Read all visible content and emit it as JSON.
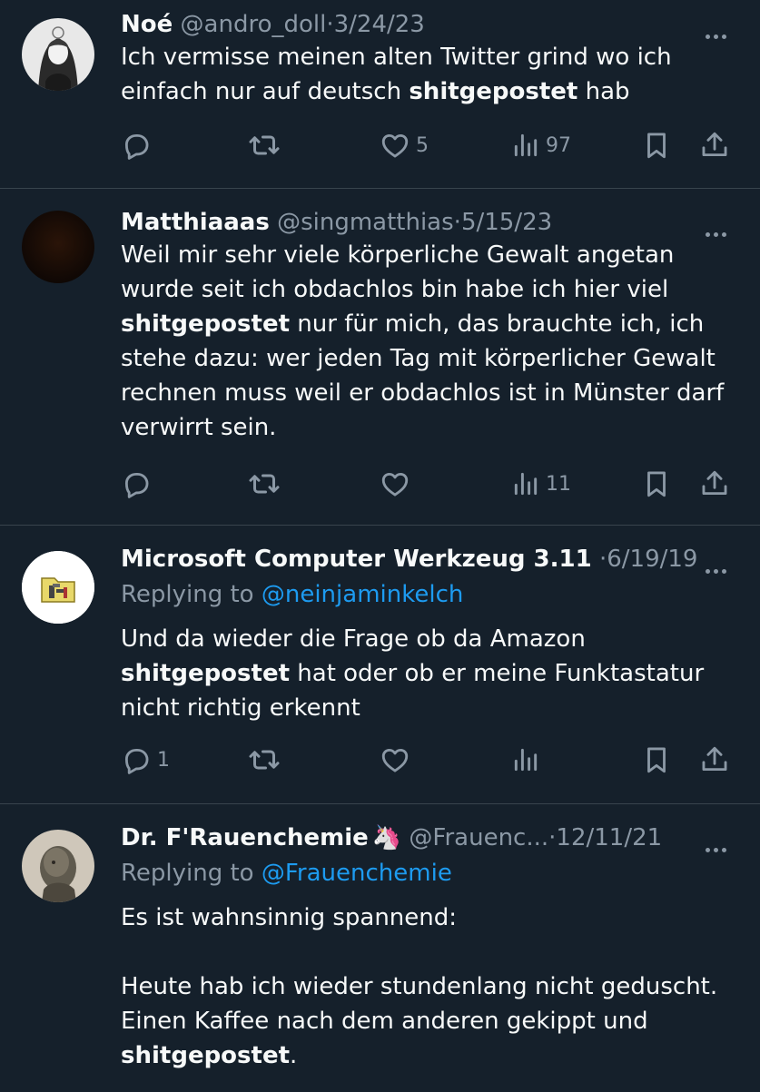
{
  "tweets": [
    {
      "name": "Noé",
      "handle": "@andro_doll",
      "dot": "·",
      "date": "3/24/23",
      "text_before": "Ich vermisse meinen alten Twitter grind wo ich einfach nur auf deutsch ",
      "bold": "shitgepostet",
      "text_after": " hab",
      "replies": "",
      "likes": "5",
      "views": "97"
    },
    {
      "name": "Matthiaaas",
      "handle": "@singmatthias",
      "dot": "·",
      "date": "5/15/23",
      "text_before": "Weil mir sehr viele körperliche Gewalt angetan wurde seit ich obdachlos bin habe ich hier viel ",
      "bold": "shitgepostet",
      "text_after": " nur für mich, das brauchte ich, ich stehe dazu: wer jeden Tag mit körperlicher Gewalt rechnen muss weil er obdachlos ist in Münster darf verwirrt sein.",
      "replies": "",
      "likes": "",
      "views": "11"
    },
    {
      "name": "Microsoft Computer Werkzeug 3.11",
      "handle": "",
      "dot": "·",
      "date": "6/19/19",
      "replying_label": "Replying to",
      "replying_to": "@neinjaminkelch",
      "text_before": "Und da wieder die Frage ob da Amazon ",
      "bold": "shitgepostet",
      "text_after": " hat oder ob er meine Funktastatur nicht richtig erkennt",
      "replies": "1",
      "likes": "",
      "views": ""
    },
    {
      "name": "Dr. F'Rauenchemie",
      "emoji": "🦄",
      "handle": "@Frauenc...",
      "dot": "·",
      "date": "12/11/21",
      "replying_label": "Replying to",
      "replying_to": "@Frauenchemie",
      "line1": "Es ist wahnsinnig spannend:",
      "text_before": "Heute hab ich wieder stundenlang nicht geduscht. Einen Kaffee nach dem anderen gekippt und ",
      "bold": "shitgepostet",
      "text_after": "."
    }
  ],
  "icons": {
    "reply": "reply-icon",
    "retweet": "retweet-icon",
    "like": "heart-icon",
    "views": "views-icon",
    "bookmark": "bookmark-icon",
    "share": "share-icon",
    "more": "more-icon"
  },
  "colors": {
    "background": "#15202b",
    "text": "#f7f9f9",
    "secondary": "#8b98a5",
    "link": "#1d9bf0",
    "divider": "#38444d"
  }
}
